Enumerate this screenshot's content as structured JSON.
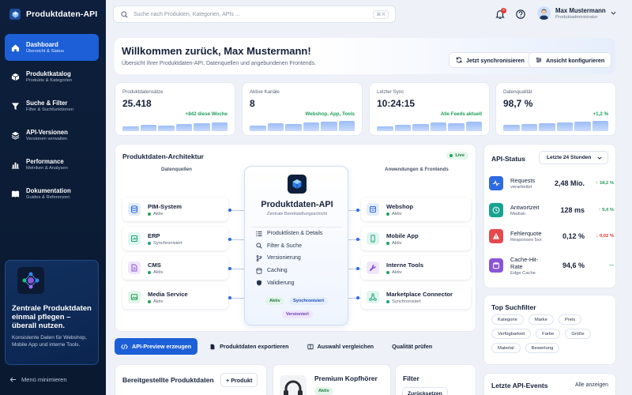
{
  "app": {
    "title": "Produktdaten-API"
  },
  "sidebar": {
    "items": [
      {
        "label": "Dashboard",
        "sub": "Übersicht & Status"
      },
      {
        "label": "Produktkatalog",
        "sub": "Produkte & Kategorien"
      },
      {
        "label": "Suche & Filter",
        "sub": "Filter & Suchfunktionen"
      },
      {
        "label": "API-Versionen",
        "sub": "Versionen verwalten"
      },
      {
        "label": "Performance",
        "sub": "Metriken & Analysen"
      },
      {
        "label": "Dokumentation",
        "sub": "Guides & Referenzen"
      }
    ],
    "promo": {
      "title": "Zentrale Produktdaten einmal pflegen – überall nutzen.",
      "text": "Konsistente Daten für Webshop, Mobile App und interne Tools."
    },
    "collapse_label": "Menü minimieren"
  },
  "topbar": {
    "search_placeholder": "Suche nach Produkten, Kategorien, APIs ...",
    "shortcut": "⌘ K",
    "notification_count": "3",
    "user": {
      "name": "Max Mustermann",
      "role": "Produktadministrator"
    }
  },
  "welcome": {
    "title": "Willkommen zurück, Max Mustermann!",
    "subtitle": "Übersicht Ihrer Produktdaten-API, Datenquellen und angebundenen Frontends.",
    "sync_label": "Jetzt synchronisieren",
    "configure_label": "Ansicht konfigurieren"
  },
  "kpis": [
    {
      "label": "Produktdatensätze",
      "value": "25.418",
      "delta": "+842 diese Woche",
      "bars": [
        0.3,
        0.4,
        0.35,
        0.45,
        0.5,
        0.55
      ]
    },
    {
      "label": "Aktive Kanäle",
      "value": "8",
      "delta": "Webshop, App, Tools",
      "bars": [
        0.35,
        0.5,
        0.45,
        0.55,
        0.6,
        0.65
      ]
    },
    {
      "label": "Letzter Sync",
      "value": "10:24:15",
      "delta": "Alle Feeds aktuell",
      "bars": [
        0.3,
        0.4,
        0.45,
        0.55,
        0.5,
        0.6
      ]
    },
    {
      "label": "Datenqualität",
      "value": "98,7 %",
      "delta": "+1,2 %",
      "bars": [
        0.4,
        0.45,
        0.5,
        0.55,
        0.6,
        0.65
      ]
    }
  ],
  "architecture": {
    "title": "Produktdaten-Architektur",
    "live": "Live",
    "left_head": "Datenquellen",
    "right_head": "Anwendungen & Frontends",
    "sources": [
      {
        "name": "PIM-System",
        "status": "Aktiv",
        "color": "#2e6ae0"
      },
      {
        "name": "ERP",
        "status": "Synchronisiert",
        "color": "#1aa37a"
      },
      {
        "name": "CMS",
        "status": "Aktiv",
        "color": "#8a55d6"
      },
      {
        "name": "Media Service",
        "status": "Aktiv",
        "color": "#20a05a"
      }
    ],
    "targets": [
      {
        "name": "Webshop",
        "status": "Aktiv",
        "color": "#2e6ae0"
      },
      {
        "name": "Mobile App",
        "status": "Aktiv",
        "color": "#1aa37a"
      },
      {
        "name": "Interne Tools",
        "status": "Aktiv",
        "color": "#8a55d6"
      },
      {
        "name": "Marketplace Connector",
        "status": "Synchronisiert",
        "color": "#1aa37a"
      }
    ],
    "hub": {
      "title": "Produktdaten-API",
      "subtitle": "Zentrale Bereitstellungsschicht",
      "items": [
        "Produktlisten & Details",
        "Filter & Suche",
        "Versionierung",
        "Caching",
        "Validierung"
      ],
      "pills": [
        "Aktiv",
        "Synchronisiert",
        "Versioniert"
      ]
    }
  },
  "api_status": {
    "title": "API-Status",
    "range": "Letzte 24 Stunden",
    "rows": [
      {
        "name": "Requests",
        "sub": "verarbeitet",
        "value": "2,48 Mio.",
        "delta": "↑ 18,2 %",
        "delta_color": "#20a05a",
        "color": "#2e6ae0"
      },
      {
        "name": "Antwortzeit",
        "sub": "Median",
        "value": "128 ms",
        "delta": "↑ 9,4 %",
        "delta_color": "#20a05a",
        "color": "#17a392"
      },
      {
        "name": "Fehlerquote",
        "sub": "Responses 5xx",
        "value": "0,12 %",
        "delta": "↓ 0,02 %",
        "delta_color": "#e03131",
        "color": "#e5484d"
      },
      {
        "name": "Cache-Hit-Rate",
        "sub": "Edge Cache",
        "value": "94,6 %",
        "delta": "—",
        "delta_color": "#20a05a",
        "color": "#8a55d6"
      }
    ]
  },
  "filters": {
    "title": "Top Suchfilter",
    "chips": [
      "Kategorie",
      "Marke",
      "Preis",
      "Verfügbarkeit",
      "Farbe",
      "Größe",
      "Material",
      "Bewertung"
    ]
  },
  "actions": {
    "preview": "API-Preview erzeugen",
    "export": "Produktdaten exportieren",
    "compare": "Auswahl vergleichen",
    "quality": "Qualität prüfen"
  },
  "bottom": {
    "products_title": "Bereitgestellte Produktdaten",
    "add_product": "+ Produkt",
    "product_name": "Premium Kopfhörer",
    "product_status": "Aktiv",
    "filter_title": "Filter",
    "reset_label": "Zurücksetzen",
    "events_title": "Letzte API-Events",
    "show_all": "Alle anzeigen"
  }
}
